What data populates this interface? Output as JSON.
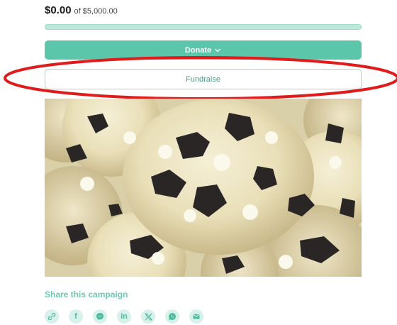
{
  "campaign": {
    "raised": "$0.00",
    "goal_text": "of $5,000.00",
    "progress_percent": 0
  },
  "buttons": {
    "donate_label": "Donate",
    "donate_icon": "chevron-down-icon",
    "fundraise_label": "Fundraise"
  },
  "image": {
    "subject": "cookies-and-cream cookies photo"
  },
  "share": {
    "title": "Share this campaign",
    "icons": [
      "link-icon",
      "facebook-icon",
      "messenger-icon",
      "linkedin-icon",
      "x-icon",
      "whatsapp-icon",
      "email-icon"
    ],
    "linkedin_glyph": "in",
    "facebook_glyph": "f"
  },
  "colors": {
    "accent": "#5cc6ab",
    "annotation": "#e01b1b"
  }
}
